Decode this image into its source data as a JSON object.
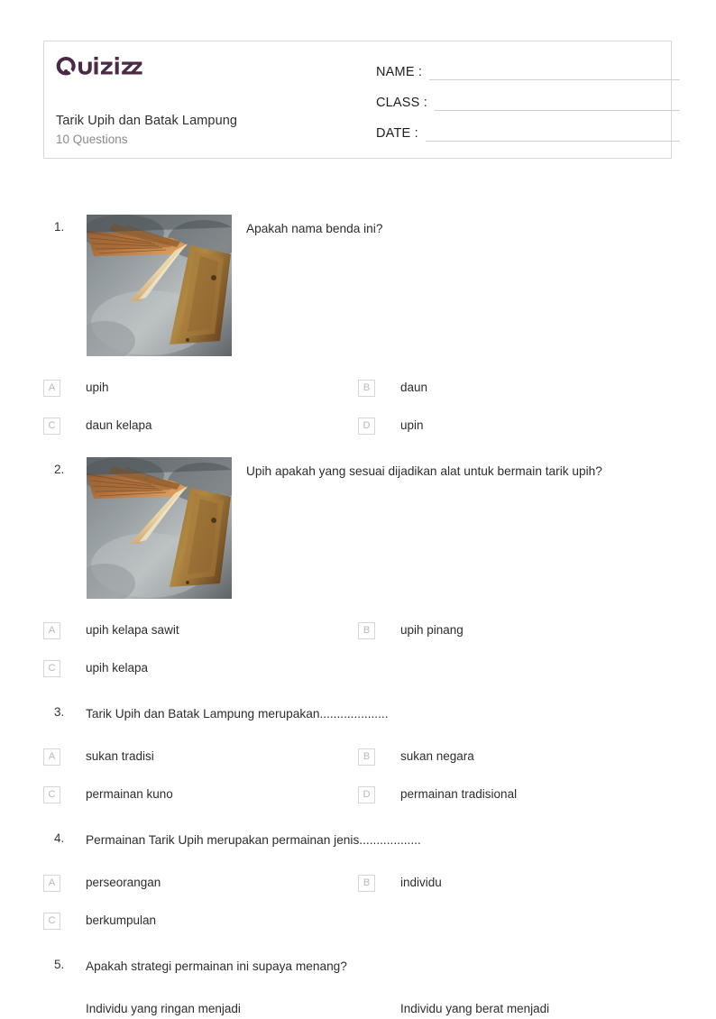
{
  "brand": {
    "logo_text": "Quizizz",
    "logo_color": "#4a2a46"
  },
  "header": {
    "quiz_title": "Tarik Upih dan Batak Lampung",
    "question_count_label": "10 Questions",
    "fields": [
      {
        "label": "NAME :"
      },
      {
        "label": "CLASS :"
      },
      {
        "label": "DATE  :"
      }
    ]
  },
  "questions": [
    {
      "number": "1.",
      "text": "Apakah nama benda ini?",
      "has_image": true,
      "image_alt": "dried palm frond upih on gray stone",
      "options": [
        {
          "letter": "A",
          "text": "upih"
        },
        {
          "letter": "B",
          "text": "daun"
        },
        {
          "letter": "C",
          "text": "daun kelapa"
        },
        {
          "letter": "D",
          "text": "upin"
        }
      ]
    },
    {
      "number": "2.",
      "text": "Upih apakah yang sesuai dijadikan alat untuk bermain tarik upih?",
      "has_image": true,
      "image_alt": "dried palm frond upih on gray stone",
      "options": [
        {
          "letter": "A",
          "text": "upih kelapa sawit"
        },
        {
          "letter": "B",
          "text": "upih pinang"
        },
        {
          "letter": "C",
          "text": "upih kelapa"
        }
      ]
    },
    {
      "number": "3.",
      "text": "Tarik Upih dan Batak Lampung merupakan....................",
      "has_image": false,
      "options": [
        {
          "letter": "A",
          "text": "sukan tradisi"
        },
        {
          "letter": "B",
          "text": "sukan negara"
        },
        {
          "letter": "C",
          "text": "permainan kuno"
        },
        {
          "letter": "D",
          "text": "permainan tradisional"
        }
      ]
    },
    {
      "number": "4.",
      "text": "Permainan Tarik Upih merupakan permainan jenis..................",
      "has_image": false,
      "options": [
        {
          "letter": "A",
          "text": "perseorangan"
        },
        {
          "letter": "B",
          "text": "individu"
        },
        {
          "letter": "C",
          "text": "berkumpulan"
        }
      ]
    },
    {
      "number": "5.",
      "text": "Apakah strategi permainan ini supaya menang?",
      "has_image": false,
      "options": [
        {
          "letter": "",
          "text": "Individu yang ringan menjadi"
        },
        {
          "letter": "",
          "text": "Individu yang berat menjadi"
        }
      ]
    }
  ]
}
